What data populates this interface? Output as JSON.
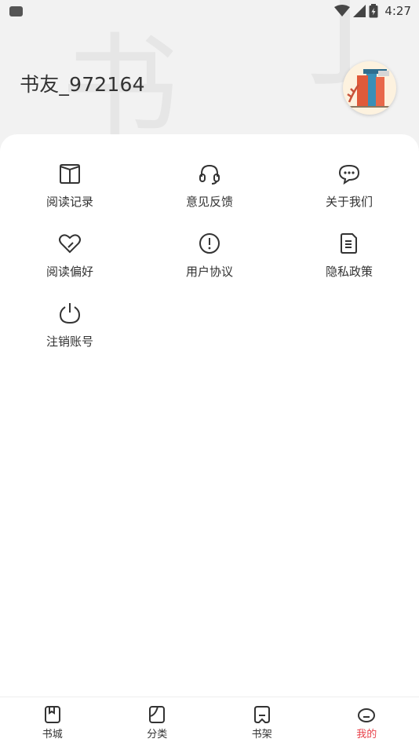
{
  "status_bar": {
    "time": "4:27"
  },
  "profile": {
    "username": "书友_972164"
  },
  "menu": {
    "items": [
      {
        "label": "阅读记录",
        "icon": "book-open-icon"
      },
      {
        "label": "意见反馈",
        "icon": "headset-icon"
      },
      {
        "label": "关于我们",
        "icon": "chat-bubble-icon"
      },
      {
        "label": "阅读偏好",
        "icon": "heart-icon"
      },
      {
        "label": "用户协议",
        "icon": "alert-circle-icon"
      },
      {
        "label": "隐私政策",
        "icon": "document-icon"
      },
      {
        "label": "注销账号",
        "icon": "power-icon"
      }
    ]
  },
  "tabbar": {
    "tabs": [
      {
        "label": "书城",
        "icon": "bookstore-icon"
      },
      {
        "label": "分类",
        "icon": "category-icon"
      },
      {
        "label": "书架",
        "icon": "bookshelf-icon"
      },
      {
        "label": "我的",
        "icon": "profile-icon"
      }
    ],
    "active_index": 3
  },
  "colors": {
    "accent": "#e8424b",
    "text": "#333333",
    "header_bg": "#f2f2f2"
  }
}
